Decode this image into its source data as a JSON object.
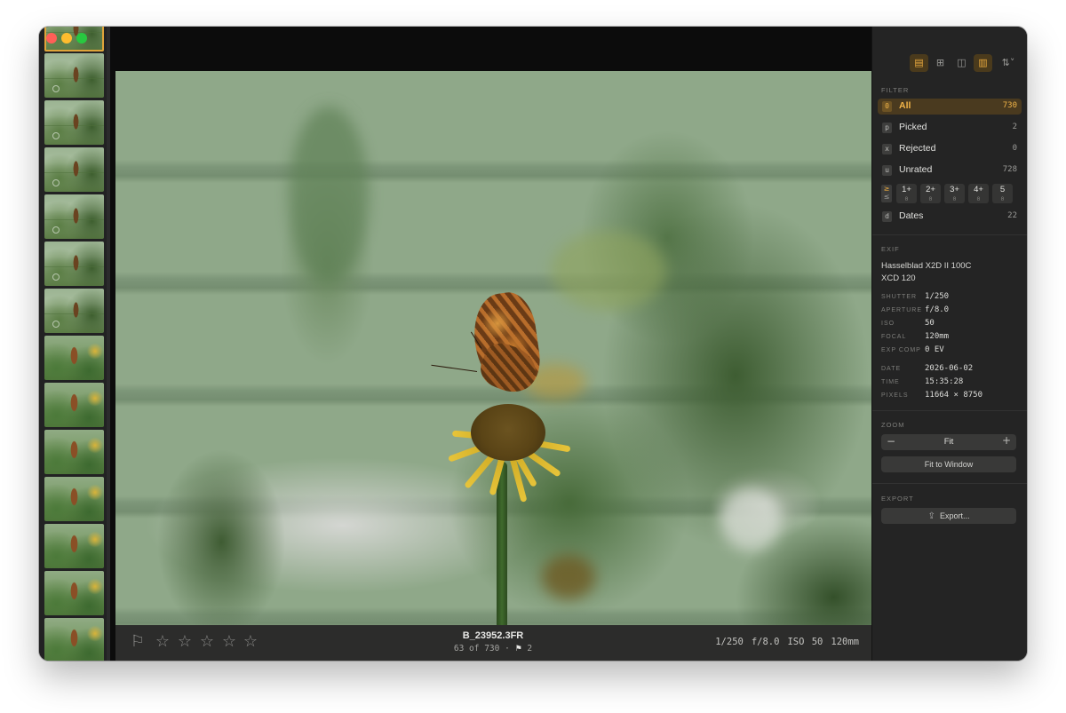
{
  "window": {
    "traffic_lights": {
      "close_color": "#ff5f57",
      "minimize_color": "#febc2e",
      "maximize_color": "#28c840"
    }
  },
  "filmstrip": {
    "thumbnail_count": 14,
    "selected_color": "#e0a43a"
  },
  "photo_info": {
    "filename": "B_23952.3FR",
    "position": "63 of 730",
    "separator": "·",
    "flag_icon": "flag-icon",
    "flag_count": "2",
    "exif_summary": [
      "1/250",
      "f/8.0",
      "ISO 50",
      "120mm"
    ]
  },
  "rating_bar": {
    "flag_icon": "flag-outline-icon",
    "stars": [
      "☆",
      "☆",
      "☆",
      "☆",
      "☆"
    ]
  },
  "toolbar": {
    "icons": [
      "sidebar-left-icon",
      "grid-icon",
      "split-view-icon",
      "sidebar-right-icon",
      "sort-icon"
    ],
    "glyphs": [
      "▤",
      "⊞",
      "◫",
      "▥",
      "⇅"
    ],
    "active_color": "#e8a93e"
  },
  "filter": {
    "title": "FILTER",
    "items": [
      {
        "key": "0",
        "label": "All",
        "count": "730",
        "active": true
      },
      {
        "key": "p",
        "label": "Picked",
        "count": "2",
        "active": false
      },
      {
        "key": "x",
        "label": "Rejected",
        "count": "0",
        "active": false
      },
      {
        "key": "u",
        "label": "Unrated",
        "count": "728",
        "active": false
      }
    ],
    "comparator": {
      "ge": "≥",
      "le": "≤"
    },
    "ratings": [
      {
        "label": "1+",
        "count": "0"
      },
      {
        "label": "2+",
        "count": "0"
      },
      {
        "label": "3+",
        "count": "0"
      },
      {
        "label": "4+",
        "count": "0"
      },
      {
        "label": "5",
        "count": "0"
      }
    ],
    "dates": {
      "key": "d",
      "label": "Dates",
      "count": "22"
    }
  },
  "exif": {
    "title": "EXIF",
    "camera": "Hasselblad X2D II 100C",
    "lens": "XCD 120",
    "rows": [
      {
        "label": "SHUTTER",
        "value": "1/250"
      },
      {
        "label": "APERTURE",
        "value": "f/8.0"
      },
      {
        "label": "ISO",
        "value": "50"
      },
      {
        "label": "FOCAL",
        "value": "120mm"
      },
      {
        "label": "EXP COMP",
        "value": "0 EV"
      }
    ],
    "rows2": [
      {
        "label": "DATE",
        "value": "2026-06-02"
      },
      {
        "label": "TIME",
        "value": "15:35:28"
      },
      {
        "label": "PIXELS",
        "value": "11664 × 8750"
      }
    ]
  },
  "zoom": {
    "title": "ZOOM",
    "minus": "−",
    "value": "Fit",
    "plus": "+",
    "fit_button": "Fit to Window"
  },
  "export": {
    "title": "EXPORT",
    "button": "Export...",
    "icon": "export-icon"
  }
}
